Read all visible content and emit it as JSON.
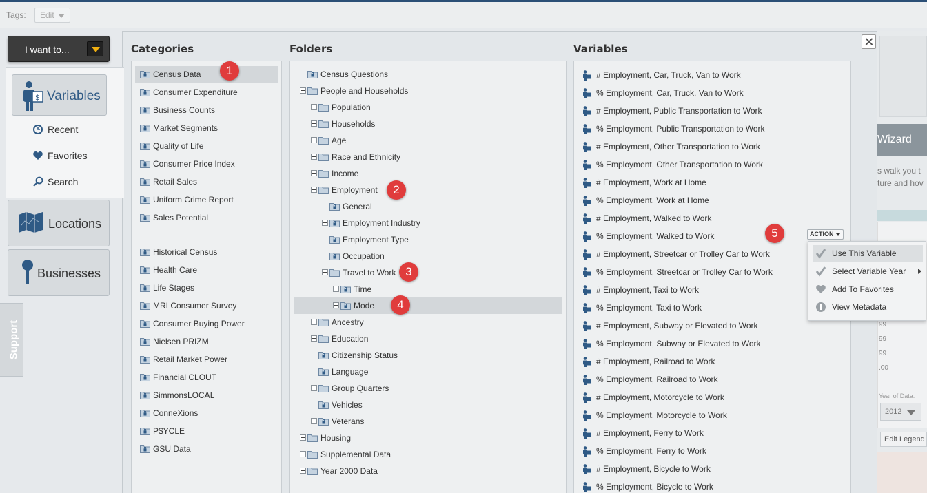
{
  "tags": {
    "label": "Tags:",
    "edit": "Edit"
  },
  "nav": {
    "i_want_to": "I want to...",
    "variables": "Variables",
    "recent": "Recent",
    "favorites": "Favorites",
    "search": "Search",
    "locations": "Locations",
    "businesses": "Businesses",
    "support": "Support"
  },
  "columns": {
    "categories": "Categories",
    "folders": "Folders",
    "variables": "Variables"
  },
  "categories_primary": [
    "Census Data",
    "Consumer Expenditure",
    "Business Counts",
    "Market Segments",
    "Quality of Life",
    "Consumer Price Index",
    "Retail Sales",
    "Uniform Crime Report",
    "Sales Potential"
  ],
  "categories_secondary": [
    "Historical Census",
    "Health Care",
    "Life Stages",
    "MRI Consumer Survey",
    "Consumer Buying Power",
    "Nielsen PRIZM",
    "Retail Market Power",
    "Financial CLOUT",
    "SimmonsLOCAL",
    "ConneXions",
    "P$YCLE",
    "GSU Data"
  ],
  "folders": [
    {
      "label": "Census Questions",
      "level": 0,
      "expander": "none",
      "icon": "locked-folder-icon"
    },
    {
      "label": "People and Households",
      "level": 0,
      "expander": "minus",
      "icon": "folder-icon"
    },
    {
      "label": "Population",
      "level": 1,
      "expander": "plus",
      "icon": "folder-icon"
    },
    {
      "label": "Households",
      "level": 1,
      "expander": "plus",
      "icon": "folder-icon"
    },
    {
      "label": "Age",
      "level": 1,
      "expander": "plus",
      "icon": "folder-icon"
    },
    {
      "label": "Race and Ethnicity",
      "level": 1,
      "expander": "plus",
      "icon": "folder-icon"
    },
    {
      "label": "Income",
      "level": 1,
      "expander": "plus",
      "icon": "folder-icon"
    },
    {
      "label": "Employment",
      "level": 1,
      "expander": "minus",
      "icon": "folder-icon"
    },
    {
      "label": "General",
      "level": 2,
      "expander": "none",
      "icon": "locked-folder-icon"
    },
    {
      "label": "Employment Industry",
      "level": 2,
      "expander": "plus",
      "icon": "locked-folder-icon"
    },
    {
      "label": "Employment Type",
      "level": 2,
      "expander": "none",
      "icon": "locked-folder-icon"
    },
    {
      "label": "Occupation",
      "level": 2,
      "expander": "none",
      "icon": "locked-folder-icon"
    },
    {
      "label": "Travel to Work",
      "level": 2,
      "expander": "minus",
      "icon": "folder-icon"
    },
    {
      "label": "Time",
      "level": 3,
      "expander": "plus",
      "icon": "locked-folder-icon"
    },
    {
      "label": "Mode",
      "level": 3,
      "expander": "plus",
      "icon": "locked-folder-icon",
      "selected": true
    },
    {
      "label": "Ancestry",
      "level": 1,
      "expander": "plus",
      "icon": "folder-icon"
    },
    {
      "label": "Education",
      "level": 1,
      "expander": "plus",
      "icon": "folder-icon"
    },
    {
      "label": "Citizenship Status",
      "level": 1,
      "expander": "none",
      "icon": "locked-folder-icon"
    },
    {
      "label": "Language",
      "level": 1,
      "expander": "none",
      "icon": "locked-folder-icon"
    },
    {
      "label": "Group Quarters",
      "level": 1,
      "expander": "plus",
      "icon": "folder-icon"
    },
    {
      "label": "Vehicles",
      "level": 1,
      "expander": "none",
      "icon": "locked-folder-icon"
    },
    {
      "label": "Veterans",
      "level": 1,
      "expander": "plus",
      "icon": "locked-folder-icon"
    },
    {
      "label": "Housing",
      "level": 0,
      "expander": "plus",
      "icon": "folder-icon"
    },
    {
      "label": "Supplemental Data",
      "level": 0,
      "expander": "plus",
      "icon": "folder-icon"
    },
    {
      "label": "Year 2000 Data",
      "level": 0,
      "expander": "plus",
      "icon": "folder-icon"
    }
  ],
  "variables": [
    "# Employment, Car, Truck, Van to Work",
    "% Employment, Car, Truck, Van to Work",
    "# Employment, Public Transportation to Work",
    "% Employment, Public Transportation to Work",
    "# Employment, Other Transportation to Work",
    "% Employment, Other Transportation to Work",
    "# Employment, Work at Home",
    "% Employment, Work at Home",
    "# Employment, Walked to Work",
    "% Employment, Walked to Work",
    "# Employment, Streetcar or Trolley Car to Work",
    "% Employment, Streetcar or Trolley Car to Work",
    "# Employment, Taxi to Work",
    "% Employment, Taxi to Work",
    "# Employment, Subway or Elevated to Work",
    "% Employment, Subway or Elevated to Work",
    "# Employment, Railroad to Work",
    "% Employment, Railroad to Work",
    "# Employment, Motorcycle to Work",
    "% Employment, Motorcycle to Work",
    "# Employment, Ferry to Work",
    "% Employment, Ferry to Work",
    "# Employment, Bicycle to Work",
    "% Employment, Bicycle to Work"
  ],
  "action": {
    "button": "ACTION",
    "menu": [
      "Use This Variable",
      "Select Variable Year",
      "Add To Favorites",
      "View Metadata"
    ]
  },
  "badges": [
    "1",
    "2",
    "3",
    "4",
    "5"
  ],
  "background": {
    "wizard": "Wizard",
    "line1": "s walk you t",
    "line2": "ture and hov",
    "nums": [
      "99",
      "99",
      "99",
      ".00"
    ],
    "year_label": "Year of Data:",
    "year": "2012",
    "edit_legend": "Edit Legend"
  },
  "colors": {
    "accent": "#2f5a85",
    "badge": "#e03c3c",
    "folder": "#7e97b1"
  }
}
